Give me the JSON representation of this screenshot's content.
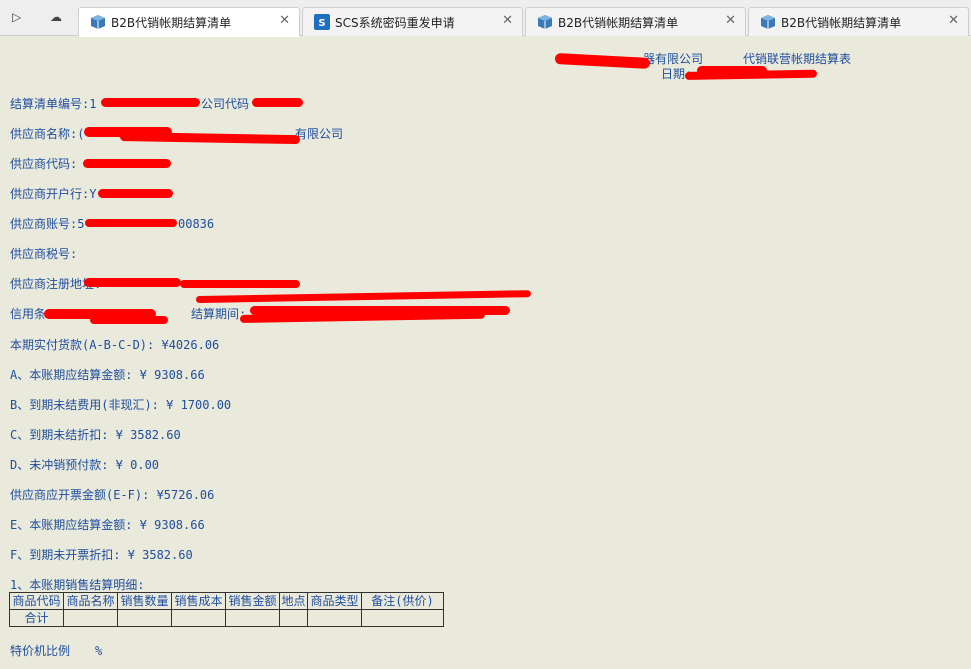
{
  "tabs": [
    {
      "label": "B2B代销帐期结算清单",
      "active": true,
      "icon": "package-icon"
    },
    {
      "label": "SCS系统密码重发申请",
      "active": false,
      "icon": "scs-icon"
    },
    {
      "label": "B2B代销帐期结算清单",
      "active": false,
      "icon": "package-icon"
    },
    {
      "label": "B2B代销帐期结算清单",
      "active": false,
      "icon": "package-icon"
    }
  ],
  "nav": {
    "forward": "▷",
    "cloud": "☁"
  },
  "header": {
    "company_suffix": "器有限公司",
    "report_title": "代销联营帐期结算表",
    "date_label": "日期:"
  },
  "fields": {
    "statement_no": "结算清单编号:1",
    "company_code": "公司代码",
    "supplier_name": "供应商名称:(",
    "supplier_name_tail": "有限公司",
    "supplier_code": "供应商代码:",
    "supplier_bank": "供应商开户行:Y",
    "supplier_account": "供应商账号:5",
    "supplier_account_tail": "00836",
    "supplier_tax": "供应商税号:",
    "supplier_address": "供应商注册地址:",
    "credit_terms": "信用条",
    "period": "结算期间:"
  },
  "amounts": {
    "actual": "本期实付货款(A-B-C-D): ¥4026.06",
    "a": "A、本账期应结算金额: ¥ 9308.66",
    "b": "B、到期未结费用(非现汇): ¥ 1700.00",
    "c": "C、到期未结折扣: ¥ 3582.60",
    "d": "D、未冲销预付款: ¥ 0.00",
    "invoice": "供应商应开票金额(E-F): ¥5726.06",
    "e": "E、本账期应结算金额: ¥ 9308.66",
    "f": "F、到期未开票折扣: ¥ 3582.60"
  },
  "detail": {
    "title": "1、本账期销售结算明细:",
    "columns": [
      "商品代码",
      "商品名称",
      "销售数量",
      "销售成本",
      "销售金额",
      "地点",
      "商品类型",
      "备注(供价)"
    ],
    "total_label": "合计"
  },
  "footer": {
    "special_ratio": "特价机比例",
    "percent": "%"
  },
  "colors": {
    "text": "#1f4e9e",
    "background": "#e9e9dc",
    "redaction": "#ff0000"
  }
}
